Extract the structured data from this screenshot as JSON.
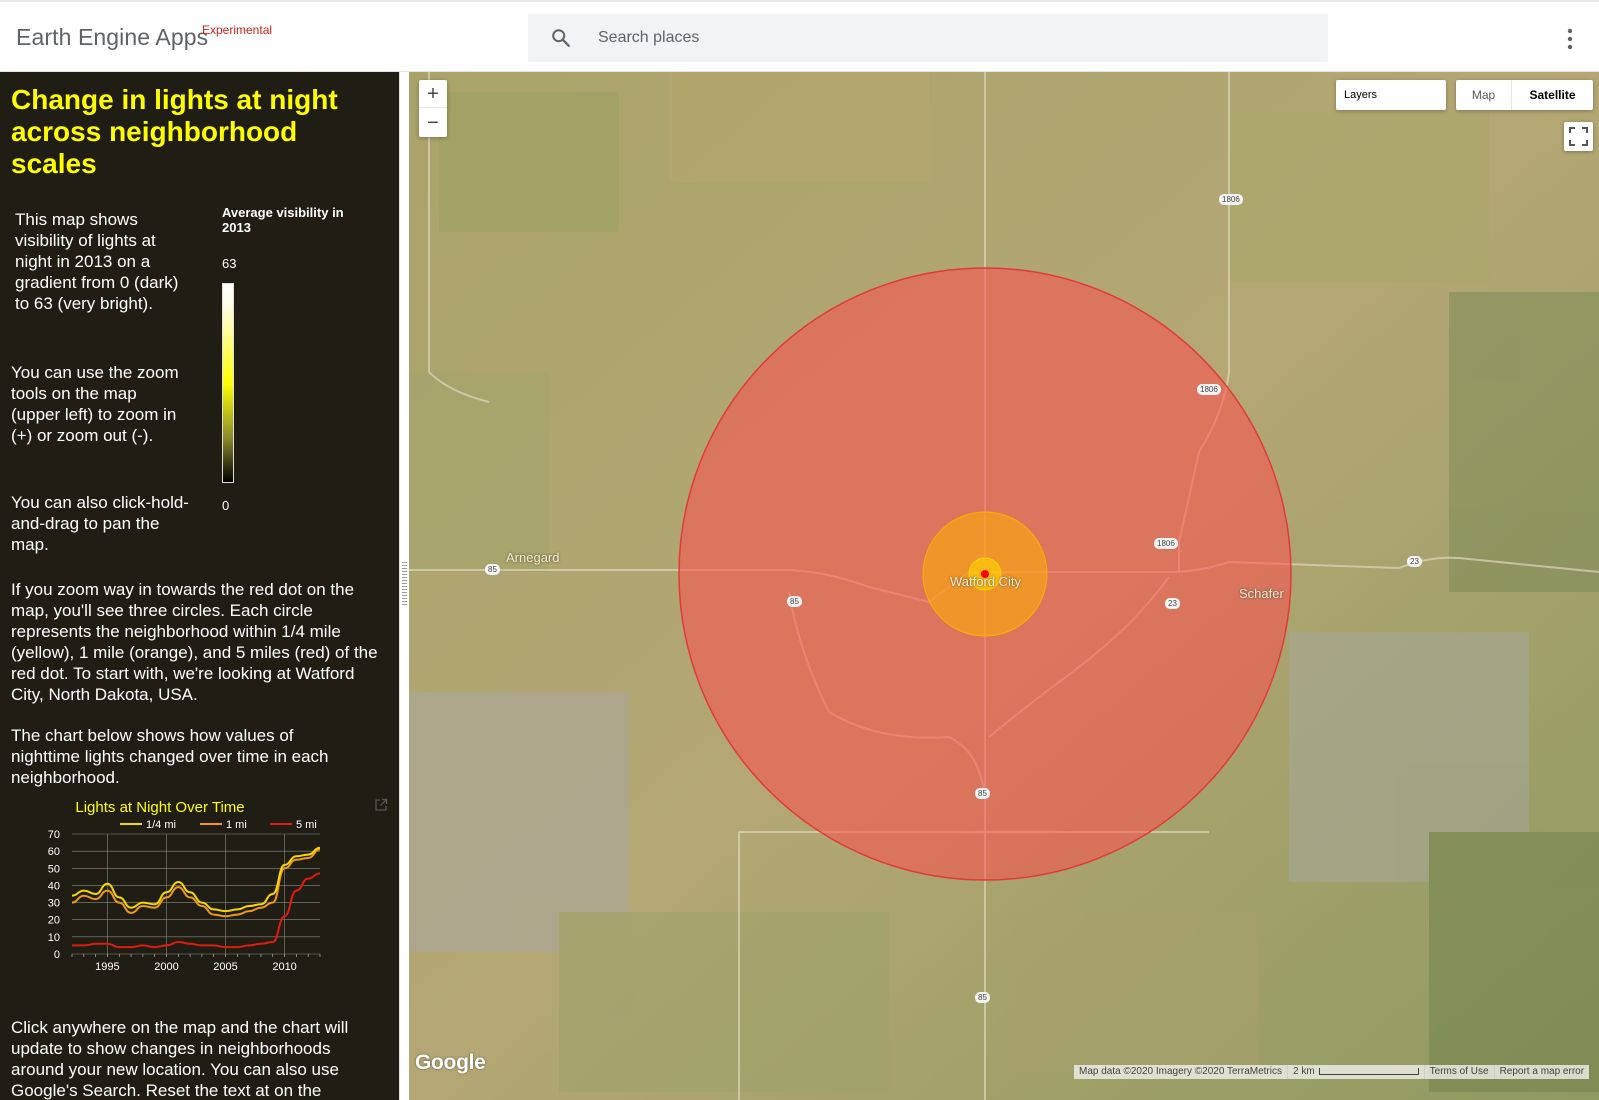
{
  "header": {
    "app_title": "Earth Engine Apps",
    "badge": "Experimental",
    "search_placeholder": "Search places",
    "search_icon": "search-icon",
    "menu_icon": "more-vert-icon"
  },
  "panel": {
    "title": "Change in lights at night across neighborhood scales",
    "intro": "This map shows visibility of lights at night in 2013 on a gradient from 0 (dark) to 63 (very bright).",
    "zoom_help": "You can use the zoom tools on the map (upper left) to zoom in (+) or zoom out (-).",
    "pan_help": "You can also click-hold-and-drag to pan the map.",
    "dot_help": "If you zoom way in towards the red dot on the map, you'll see three circles. Each circle represents the neighborhood within 1/4 mile (yellow), 1 mile (orange), and 5 miles (red) of the red dot. To start with, we're looking at Watford City, North Dakota, USA.",
    "chart_help": "The chart below shows how values of nighttime lights changed over time in each neighborhood.",
    "click_help": "Click anywhere on the map and the chart will update to show changes in neighborhoods around your new location. You can also use Google's Search. Reset the text at on the",
    "legend": {
      "title": "Average visibility in 2013",
      "max": "63",
      "min": "0",
      "colors": [
        "#ffffff",
        "#ffff00",
        "#000000"
      ]
    }
  },
  "chart_data": {
    "type": "line",
    "title": "Lights at Night Over Time",
    "xlabel": "",
    "ylabel": "",
    "ylim": [
      0,
      70
    ],
    "xlim": [
      1992,
      2013
    ],
    "yticks": [
      0,
      10,
      20,
      30,
      40,
      50,
      60,
      70
    ],
    "xticks": [
      1995,
      2000,
      2005,
      2010
    ],
    "legend_position": "top",
    "grid": true,
    "series": [
      {
        "name": "1/4 mi",
        "color": "#f5d800",
        "x": [
          1992,
          1993,
          1994,
          1995,
          1996,
          1997,
          1998,
          1999,
          2000,
          2001,
          2002,
          2003,
          2004,
          2005,
          2006,
          2007,
          2008,
          2009,
          2010,
          2011,
          2012,
          2013
        ],
        "values": [
          34,
          37,
          35,
          41,
          33,
          27,
          30,
          29,
          36,
          42,
          36,
          30,
          26,
          25,
          26,
          28,
          29,
          35,
          52,
          57,
          58,
          62
        ]
      },
      {
        "name": "1 mi",
        "color": "#ef9a16",
        "x": [
          1992,
          1993,
          1994,
          1995,
          1996,
          1997,
          1998,
          1999,
          2000,
          2001,
          2002,
          2003,
          2004,
          2005,
          2006,
          2007,
          2008,
          2009,
          2010,
          2011,
          2012,
          2013
        ],
        "values": [
          30,
          34,
          32,
          37,
          30,
          24,
          28,
          27,
          33,
          39,
          33,
          28,
          23,
          22,
          23,
          25,
          27,
          30,
          50,
          55,
          56,
          61
        ]
      },
      {
        "name": "5 mi",
        "color": "#e01b0f",
        "x": [
          1992,
          1993,
          1994,
          1995,
          1996,
          1997,
          1998,
          1999,
          2000,
          2001,
          2002,
          2003,
          2004,
          2005,
          2006,
          2007,
          2008,
          2009,
          2010,
          2011,
          2012,
          2013
        ],
        "values": [
          5,
          5,
          6,
          6,
          4,
          4,
          5,
          4,
          5,
          7,
          6,
          5,
          5,
          4,
          4,
          5,
          6,
          7,
          22,
          37,
          44,
          47
        ]
      }
    ]
  },
  "chart_ui": {
    "expand_icon": "open-in-new-icon"
  },
  "map": {
    "zoom_in": "+",
    "zoom_out": "−",
    "layers_label": "Layers",
    "maptype_map": "Map",
    "maptype_satellite": "Satellite",
    "fullscreen_icon": "fullscreen-icon",
    "places": [
      "Arnegard",
      "Watford City",
      "Schafer"
    ],
    "routes": [
      "1806",
      "1806",
      "1806",
      "85",
      "85",
      "85",
      "85",
      "23",
      "23"
    ],
    "circles": [
      {
        "name": "5 mi",
        "color": "#ff4d4d"
      },
      {
        "name": "1 mi",
        "color": "#ffae00"
      },
      {
        "name": "1/4 mi",
        "color": "#ffd500"
      }
    ],
    "point_color": "#ff0000",
    "google_logo": "Google",
    "attribution": {
      "data": "Map data ©2020 Imagery ©2020 TerraMetrics",
      "scale": "2 km",
      "terms": "Terms of Use",
      "report": "Report a map error"
    }
  }
}
